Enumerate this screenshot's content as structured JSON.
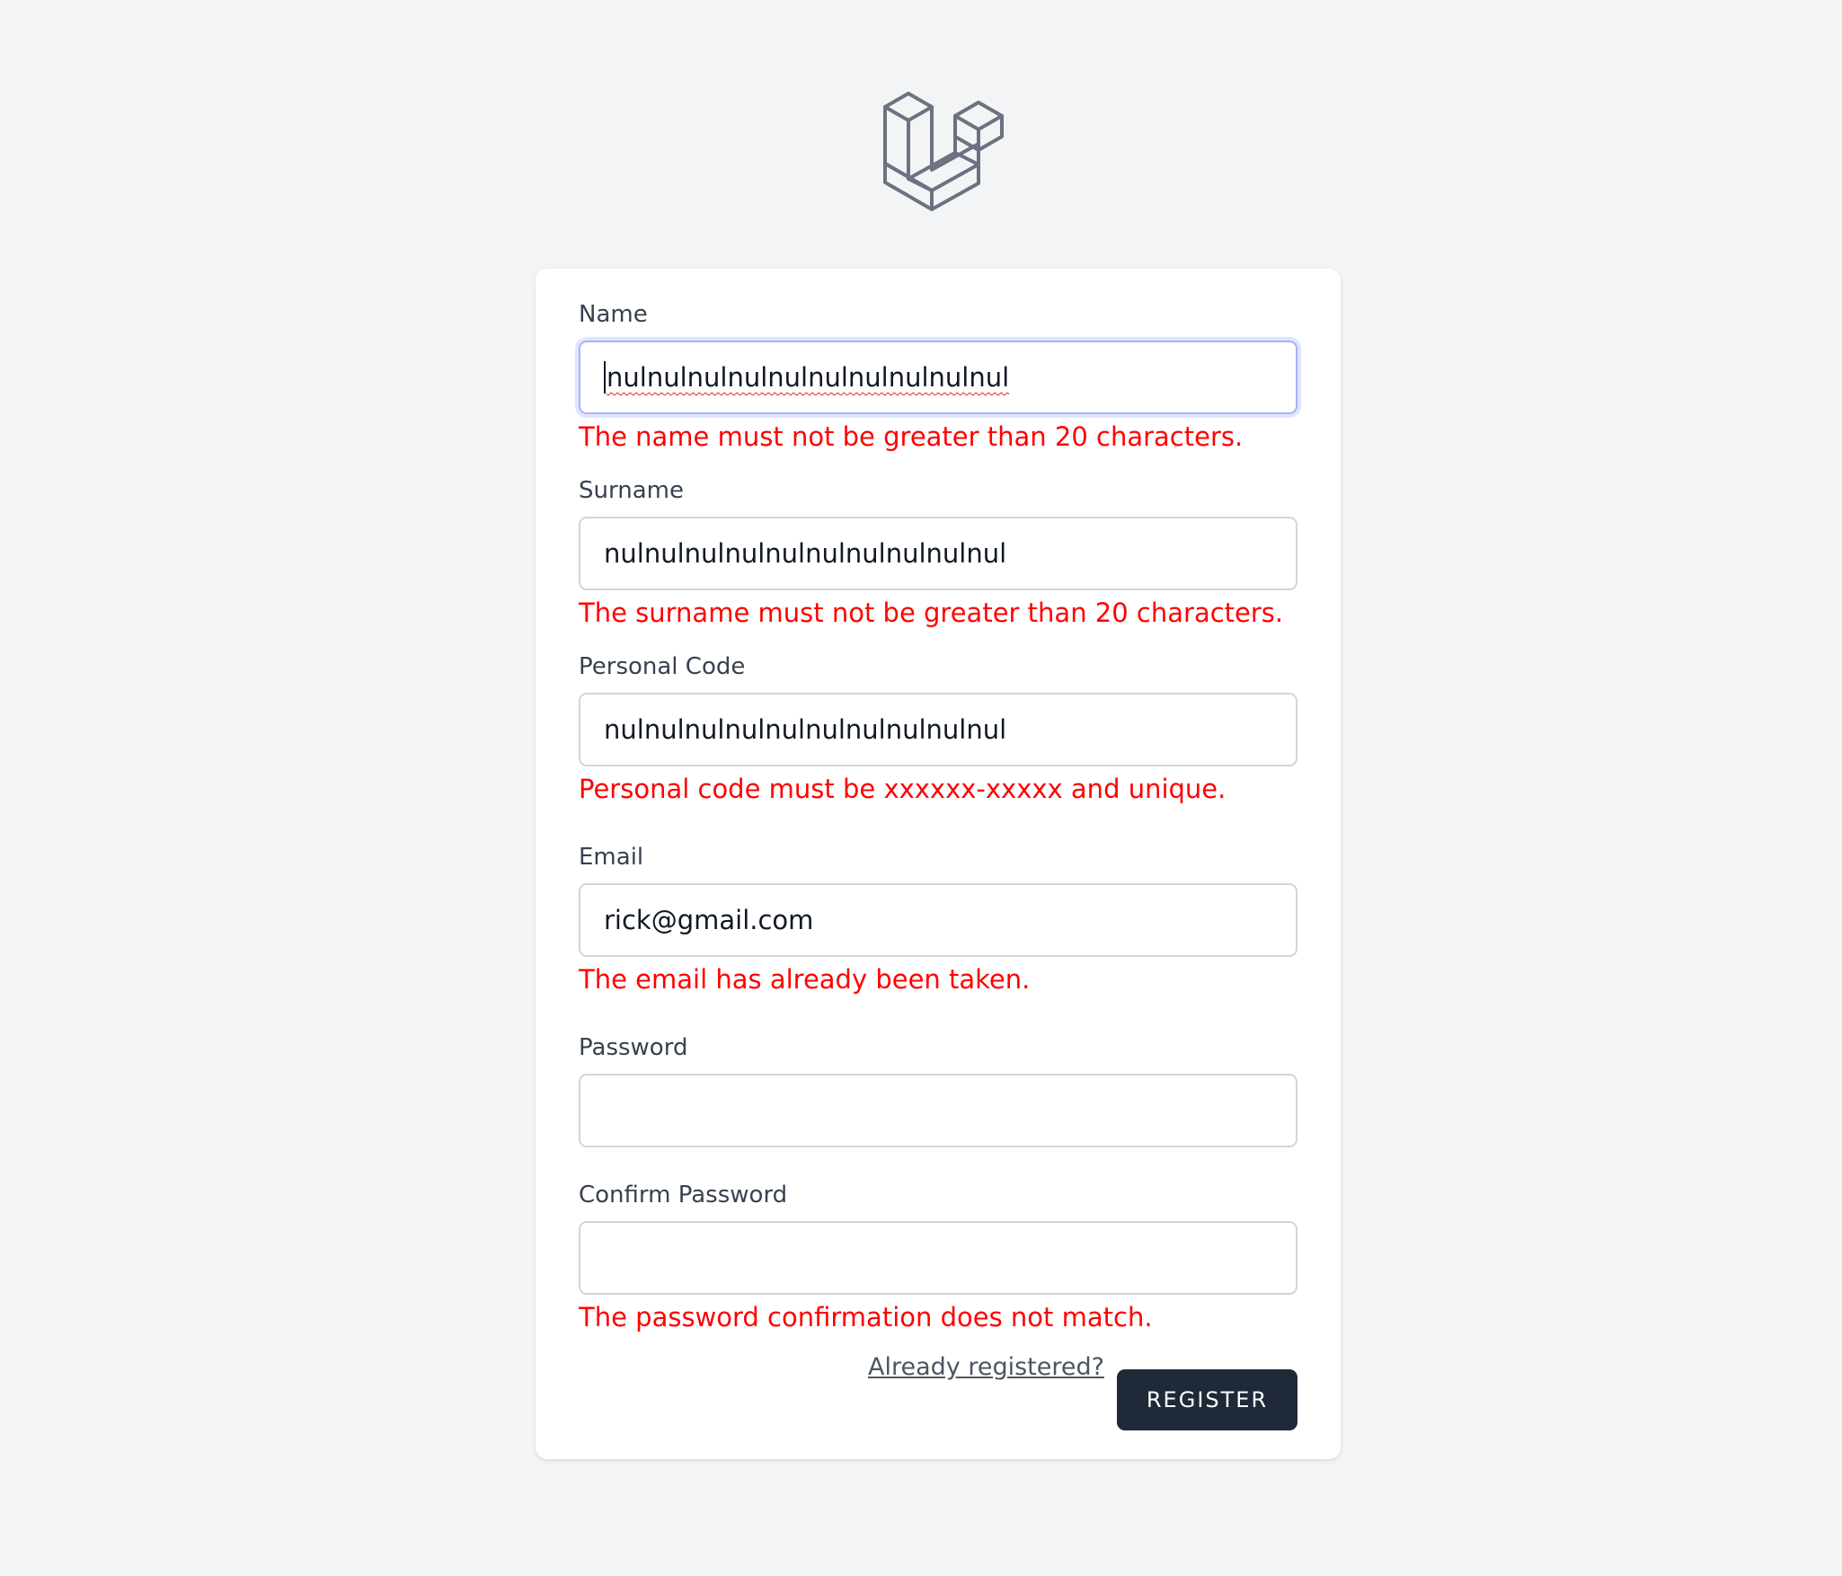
{
  "logo": {
    "icon": "laravel-logo-icon"
  },
  "form": {
    "name": {
      "label": "Name",
      "value": "nulnulnulnulnulnulnulnulnulnul",
      "error": "The name must not be greater than 20 characters."
    },
    "surname": {
      "label": "Surname",
      "value": "nulnulnulnulnulnulnulnulnulnul",
      "error": "The surname must not be greater than 20 characters."
    },
    "personal_code": {
      "label": "Personal Code",
      "value": "nulnulnulnulnulnulnulnulnulnul",
      "error": "Personal code must be xxxxxx-xxxxx and unique."
    },
    "email": {
      "label": "Email",
      "value": "rick@gmail.com",
      "error": "The email has already been taken."
    },
    "password": {
      "label": "Password",
      "value": ""
    },
    "password_confirmation": {
      "label": "Confirm Password",
      "value": "",
      "error": "The password confirmation does not match."
    }
  },
  "footer": {
    "login_link": "Already registered?",
    "register_button": "Register"
  },
  "colors": {
    "background": "#f3f4f6",
    "error": "#ff0000",
    "button": "#1f2937",
    "focus_ring": "#a5b4fc"
  }
}
